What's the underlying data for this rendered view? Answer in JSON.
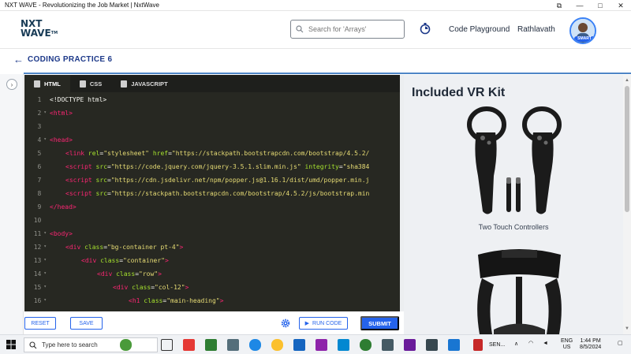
{
  "window": {
    "title": "NXT WAVE - Revolutionizing the Job Market | NxtWave"
  },
  "header": {
    "logo_line1": "NXT",
    "logo_line2": "WAVE",
    "logo_tm": "TM",
    "search_placeholder": "Search for 'Arrays'",
    "code_playground": "Code Playground",
    "user_name": "Rathlavath",
    "avatar_badge": "SMART"
  },
  "page": {
    "title": "CODING PRACTICE 6"
  },
  "editor": {
    "tabs": [
      {
        "label": "HTML",
        "active": true
      },
      {
        "label": "CSS",
        "active": false
      },
      {
        "label": "JAVASCRIPT",
        "active": false
      }
    ],
    "lines": [
      {
        "n": "1",
        "fold": false,
        "indent": 0,
        "parts": [
          [
            "plain",
            "<!DOCTYPE html>"
          ]
        ]
      },
      {
        "n": "2",
        "fold": true,
        "indent": 0,
        "parts": [
          [
            "tag",
            "<html>"
          ]
        ]
      },
      {
        "n": "3",
        "fold": false,
        "indent": 0,
        "parts": []
      },
      {
        "n": "4",
        "fold": true,
        "indent": 0,
        "parts": [
          [
            "tag",
            "<head>"
          ]
        ]
      },
      {
        "n": "5",
        "fold": false,
        "indent": 1,
        "parts": [
          [
            "tag",
            "<link "
          ],
          [
            "attr",
            "rel"
          ],
          [
            "plain",
            "="
          ],
          [
            "str",
            "\"stylesheet\""
          ],
          [
            "plain",
            " "
          ],
          [
            "attr",
            "href"
          ],
          [
            "plain",
            "="
          ],
          [
            "str",
            "\"https://stackpath.bootstrapcdn.com/bootstrap/4.5.2/"
          ]
        ]
      },
      {
        "n": "6",
        "fold": false,
        "indent": 1,
        "parts": [
          [
            "tag",
            "<script "
          ],
          [
            "attr",
            "src"
          ],
          [
            "plain",
            "="
          ],
          [
            "str",
            "\"https://code.jquery.com/jquery-3.5.1.slim.min.js\""
          ],
          [
            "plain",
            " "
          ],
          [
            "attr",
            "integrity"
          ],
          [
            "plain",
            "="
          ],
          [
            "str",
            "\"sha384"
          ]
        ]
      },
      {
        "n": "7",
        "fold": false,
        "indent": 1,
        "parts": [
          [
            "tag",
            "<script "
          ],
          [
            "attr",
            "src"
          ],
          [
            "plain",
            "="
          ],
          [
            "str",
            "\"https://cdn.jsdelivr.net/npm/popper.js@1.16.1/dist/umd/popper.min.j"
          ]
        ]
      },
      {
        "n": "8",
        "fold": false,
        "indent": 1,
        "parts": [
          [
            "tag",
            "<script "
          ],
          [
            "attr",
            "src"
          ],
          [
            "plain",
            "="
          ],
          [
            "str",
            "\"https://stackpath.bootstrapcdn.com/bootstrap/4.5.2/js/bootstrap.min"
          ]
        ]
      },
      {
        "n": "9",
        "fold": false,
        "indent": 0,
        "parts": [
          [
            "tag",
            "</head>"
          ]
        ]
      },
      {
        "n": "10",
        "fold": false,
        "indent": 0,
        "parts": []
      },
      {
        "n": "11",
        "fold": true,
        "indent": 0,
        "parts": [
          [
            "tag",
            "<body>"
          ]
        ]
      },
      {
        "n": "12",
        "fold": true,
        "indent": 1,
        "parts": [
          [
            "tag",
            "<div "
          ],
          [
            "attr",
            "class"
          ],
          [
            "plain",
            "="
          ],
          [
            "str",
            "\"bg-container pt-4\""
          ],
          [
            "tag",
            ">"
          ]
        ]
      },
      {
        "n": "13",
        "fold": true,
        "indent": 2,
        "parts": [
          [
            "tag",
            "<div "
          ],
          [
            "attr",
            "class"
          ],
          [
            "plain",
            "="
          ],
          [
            "str",
            "\"container\""
          ],
          [
            "tag",
            ">"
          ]
        ]
      },
      {
        "n": "14",
        "fold": true,
        "indent": 3,
        "parts": [
          [
            "tag",
            "<div "
          ],
          [
            "attr",
            "class"
          ],
          [
            "plain",
            "="
          ],
          [
            "str",
            "\"row\""
          ],
          [
            "tag",
            ">"
          ]
        ]
      },
      {
        "n": "15",
        "fold": true,
        "indent": 4,
        "parts": [
          [
            "tag",
            "<div "
          ],
          [
            "attr",
            "class"
          ],
          [
            "plain",
            "="
          ],
          [
            "str",
            "\"col-12\""
          ],
          [
            "tag",
            ">"
          ]
        ]
      },
      {
        "n": "16",
        "fold": true,
        "indent": 5,
        "parts": [
          [
            "tag",
            "<h1 "
          ],
          [
            "attr",
            "class"
          ],
          [
            "plain",
            "="
          ],
          [
            "str",
            "\"main-heading\""
          ],
          [
            "tag",
            ">"
          ]
        ]
      }
    ]
  },
  "actions": {
    "reset": "RESET",
    "save": "SAVE",
    "run_code": "RUN CODE",
    "submit": "SUBMIT"
  },
  "preview": {
    "title": "Included VR Kit",
    "caption": "Two Touch Controllers"
  },
  "taskbar": {
    "search_placeholder": "Type here to search",
    "app_label": "SEN...",
    "lang_line1": "ENG",
    "lang_line2": "US",
    "time": "1:44 PM",
    "date": "8/5/2024"
  },
  "colors": {
    "accent": "#2563eb",
    "editor_bg": "#272822",
    "brand_dark": "#183b56"
  }
}
